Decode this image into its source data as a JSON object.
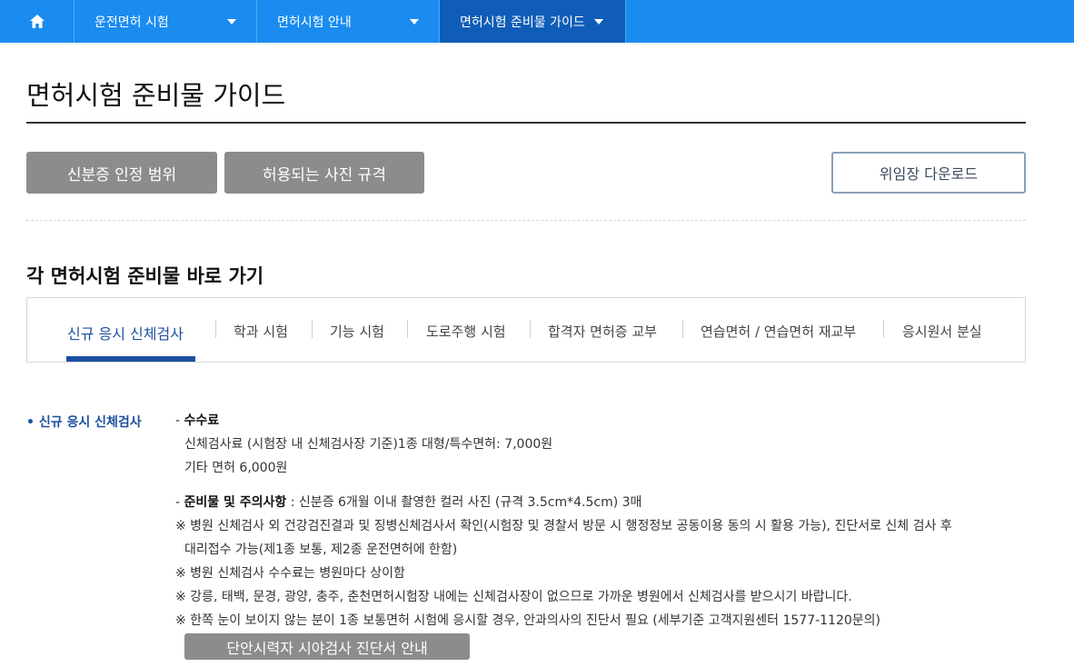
{
  "nav": {
    "items": [
      {
        "label": "운전면허 시험"
      },
      {
        "label": "면허시험 안내"
      },
      {
        "label": "면허시험 준비물 가이드"
      }
    ]
  },
  "page": {
    "title": "면허시험 준비물 가이드"
  },
  "buttons": {
    "id_scope": "신분증 인정 범위",
    "photo_spec": "허용되는 사진 규격",
    "proxy_download": "위임장 다운로드"
  },
  "section": {
    "title": "각 면허시험 준비물 바로 가기"
  },
  "tabs": [
    {
      "label": "신규 응시 신체검사"
    },
    {
      "label": "학과 시험"
    },
    {
      "label": "기능 시험"
    },
    {
      "label": "도로주행 시험"
    },
    {
      "label": "합격자 면허증 교부"
    },
    {
      "label": "연습면허 / 연습면허 재교부"
    },
    {
      "label": "응시원서 분실"
    }
  ],
  "detail": {
    "side_label": "신규 응시 신체검사",
    "fee_title": "수수료",
    "fee_line1": "신체검사료 (시험장 내 신체검사장 기준)1종 대형/특수면허: 7,000원",
    "fee_line2": "기타 면허 6,000원",
    "prep_title": "준비물 및 주의사항",
    "prep_text": " : 신분증 6개월 이내 촬영한 컬러 사진 (규격 3.5cm*4.5cm) 3매",
    "note1a": "※ 병원 신체검사 외 건강검진결과 및 징병신체검사서 확인(시험장 및 경찰서 방문 시 행정정보 공동이용 동의 시 활용 가능), 진단서로 신체 검사 후",
    "note1b": "대리접수 가능(제1종 보통, 제2종 운전면허에 한함)",
    "note2": "※ 병원 신체검사 수수료는 병원마다 상이함",
    "note3": "※ 강릉, 태백, 문경, 광양, 충주, 춘천면허시험장 내에는 신체검사장이 없으므로 가까운 병원에서 신체검사를 받으시기 바랍니다.",
    "note4": "※ 한쪽 눈이 보이지 않는 분이 1종 보통면허 시험에 응시할 경우, 안과의사의 진단서 필요 (세부기준 고객지원센터 1577-1120문의)",
    "vision_button": "단안시력자 시야검사 진단서 안내"
  }
}
